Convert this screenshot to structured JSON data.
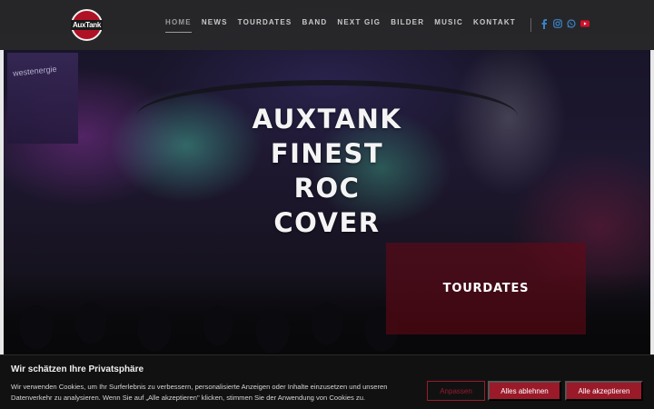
{
  "brand": {
    "logo_text": "AuxTank"
  },
  "nav": {
    "items": [
      {
        "label": "HOME",
        "active": true
      },
      {
        "label": "NEWS"
      },
      {
        "label": "TOURDATES"
      },
      {
        "label": "BAND"
      },
      {
        "label": "NEXT GIG"
      },
      {
        "label": "BILDER"
      },
      {
        "label": "MUSIC"
      },
      {
        "label": "KONTAKT"
      }
    ]
  },
  "social": [
    {
      "icon": "facebook-icon",
      "color": "#3b82c4"
    },
    {
      "icon": "instagram-icon",
      "color": "#3b82c4"
    },
    {
      "icon": "whatsapp-icon",
      "color": "#3b82c4"
    },
    {
      "icon": "youtube-icon",
      "color": "#d0102a"
    }
  ],
  "hero": {
    "banner_text": "westenergie",
    "title_lines": [
      "AUXTANK",
      "FINEST",
      "ROC",
      "COVER"
    ],
    "cta_label": "TOURDATES"
  },
  "cookie": {
    "title": "Wir schätzen Ihre Privatsphäre",
    "text": "Wir verwenden Cookies, um Ihr Surferlebnis zu verbessern, personalisierte Anzeigen oder Inhalte einzusetzen und unseren Datenverkehr zu analysieren. Wenn Sie auf „Alle akzeptieren\" klicken, stimmen Sie der Anwendung von Cookies zu.",
    "buttons": {
      "customize": "Anpassen",
      "reject": "Alles ablehnen",
      "accept": "Alle akzeptieren"
    }
  },
  "colors": {
    "accent": "#9a1a2a",
    "topbar": "#28282a",
    "social_blue": "#3b82c4"
  }
}
